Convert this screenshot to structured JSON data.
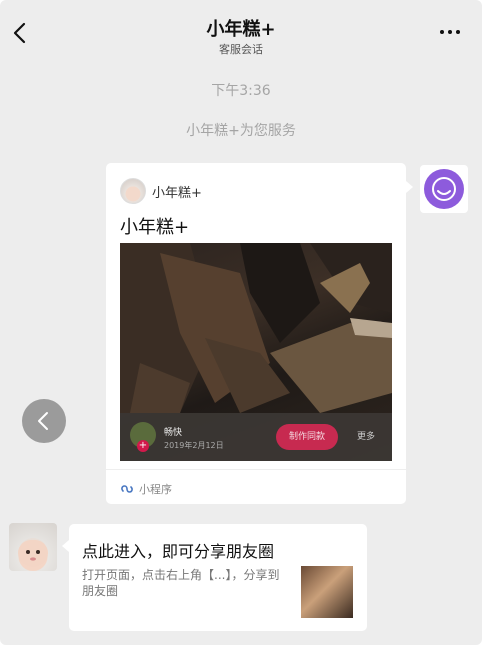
{
  "header": {
    "title": "小年糕+",
    "subtitle": "客服会话",
    "back_icon": "chevron-left-icon",
    "more_icon": "more-dots-icon"
  },
  "system": {
    "time": "下午3:36",
    "service_note": "小年糕+为您服务"
  },
  "card": {
    "app_name": "小年糕+",
    "title": "小年糕+",
    "user_name": "畅快",
    "date": "2019年2月12日",
    "make_button": "制作同款",
    "more_label": "更多",
    "footer_label": "小程序",
    "footer_icon": "miniprogram-icon"
  },
  "message": {
    "title": "点此进入，即可分享朋友圈",
    "desc": "打开页面，点击右上角【...】，分享到朋友圈"
  },
  "colors": {
    "background": "#ededed",
    "accent_purple": "#8d5bdc",
    "accent_red": "#c72a50"
  }
}
